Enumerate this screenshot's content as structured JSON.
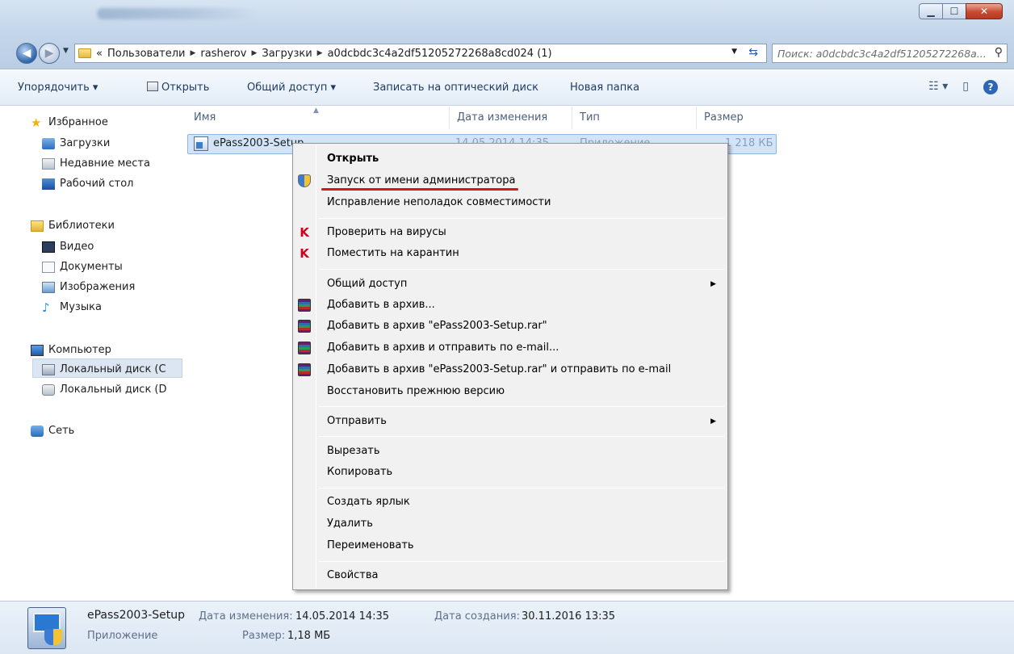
{
  "window": {
    "controls": {
      "minimize": "▁",
      "maximize": "☐",
      "close": "✕"
    }
  },
  "address": {
    "prefix": "«",
    "crumbs": [
      "Пользователи",
      "rasherov",
      "Загрузки",
      "a0dcbdc3c4a2df51205272268a8cd024 (1)"
    ],
    "search_placeholder": "Поиск: a0dcbdc3c4a2df51205272268a..."
  },
  "toolbar": {
    "organize": "Упорядочить ▾",
    "open": "Открыть",
    "share": "Общий доступ ▾",
    "burn": "Записать на оптический диск",
    "new_folder": "Новая папка"
  },
  "nav": {
    "favorites": "Избранное",
    "downloads": "Загрузки",
    "recent": "Недавние места",
    "desktop": "Рабочий стол",
    "libraries": "Библиотеки",
    "video": "Видео",
    "documents": "Документы",
    "images": "Изображения",
    "music": "Музыка",
    "computer": "Компьютер",
    "disk_c": "Локальный диск (C",
    "disk_d": "Локальный диск (D",
    "network": "Сеть"
  },
  "columns": {
    "name": "Имя",
    "date": "Дата изменения",
    "type": "Тип",
    "size": "Размер"
  },
  "file": {
    "name": "ePass2003-Setup",
    "date": "14.05.2014 14:35",
    "type": "Приложение",
    "size": "1 218 КБ"
  },
  "context_menu": {
    "open": "Открыть",
    "run_as_admin": "Запуск от имени администратора",
    "compat": "Исправление неполадок совместимости",
    "scan": "Проверить на вирусы",
    "quarantine": "Поместить на карантин",
    "share": "Общий доступ",
    "add_archive": "Добавить в архив...",
    "add_archive_rar": "Добавить в архив \"ePass2003-Setup.rar\"",
    "add_archive_email": "Добавить в архив и отправить по e-mail...",
    "add_archive_rar_email": "Добавить в архив \"ePass2003-Setup.rar\" и отправить по e-mail",
    "restore": "Восстановить прежнюю версию",
    "send_to": "Отправить",
    "cut": "Вырезать",
    "copy": "Копировать",
    "shortcut": "Создать ярлык",
    "delete": "Удалить",
    "rename": "Переименовать",
    "properties": "Свойства"
  },
  "details": {
    "name": "ePass2003-Setup",
    "modified_label": "Дата изменения:",
    "modified_value": "14.05.2014 14:35",
    "created_label": "Дата создания:",
    "created_value": "30.11.2016 13:35",
    "type": "Приложение",
    "size_label": "Размер:",
    "size_value": "1,18 МБ"
  },
  "colors": {
    "accent": "#2d66b4",
    "selection": "#d2e5f8",
    "highlight_underline": "#d11a1a"
  }
}
